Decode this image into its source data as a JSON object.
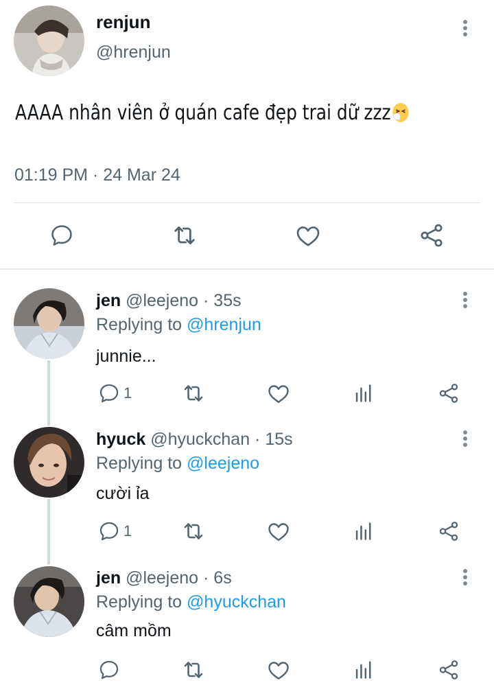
{
  "main_tweet": {
    "name": "renjun",
    "handle": "@hrenjun",
    "text": "AAAA nhân viên ở quán cafe đẹp trai dữ zzz",
    "emoji": "sneezing-face-emoji",
    "timestamp": "01:19 PM · 24 Mar 24"
  },
  "replies": [
    {
      "name": "jen",
      "meta": " @leejeno · 35s",
      "replying_prefix": "Replying to ",
      "replying_to": "@hrenjun",
      "text": "junnie...",
      "reply_count": "1"
    },
    {
      "name": "hyuck",
      "meta": " @hyuckchan · 15s",
      "replying_prefix": "Replying to ",
      "replying_to": "@leejeno",
      "text": "cười ỉa",
      "reply_count": "1"
    },
    {
      "name": "jen",
      "meta": " @leejeno · 6s",
      "replying_prefix": "Replying to ",
      "replying_to": "@hyuckchan",
      "text": "câm mồm",
      "reply_count": ""
    }
  ],
  "icons": [
    "comment-icon",
    "retweet-icon",
    "like-icon",
    "share-icon",
    "views-icon",
    "more-icon"
  ],
  "colors": {
    "link": "#1d9bf0",
    "secondary_text": "#536471",
    "icon": "#536471",
    "thread_line": "#cfd9de"
  }
}
